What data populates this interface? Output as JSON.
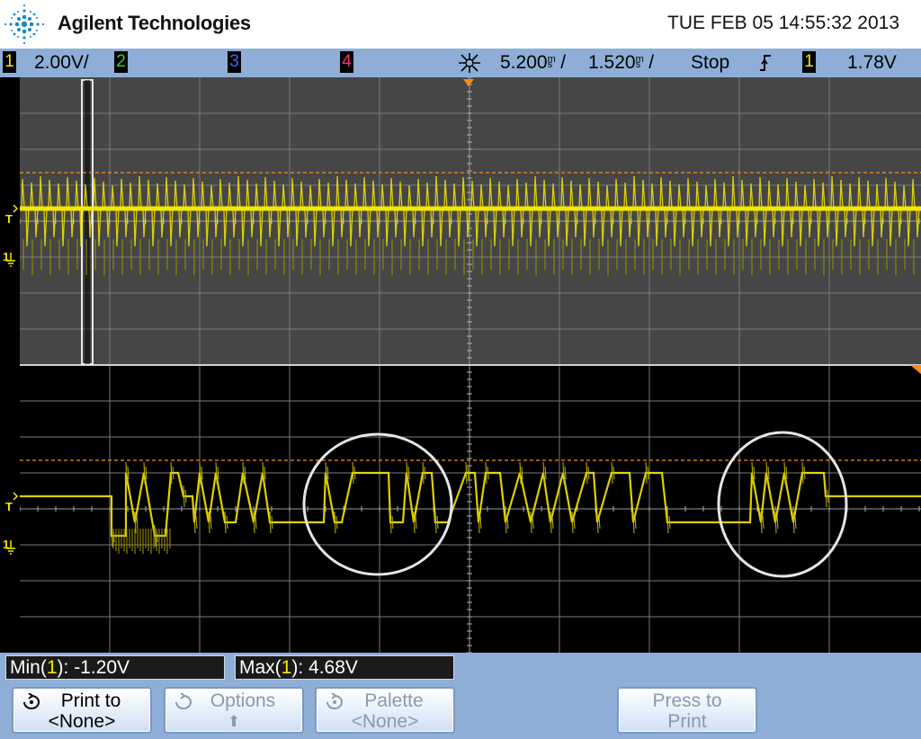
{
  "header": {
    "brand": "Agilent Technologies",
    "datetime": "TUE FEB 05 14:55:32 2013",
    "logo_icon": "agilent-spark-logo-icon"
  },
  "statusbar": {
    "ch1_label": "1",
    "ch1_scale": "2.00V/",
    "ch2_label": "2",
    "ch3_label": "3",
    "ch4_label": "4",
    "timebase_icon": "acquisition-zoom-icon",
    "delay": "5.200s/",
    "timescale": "1.520ms/",
    "run_state": "Stop",
    "trigger_slope_icon": "rising-edge-icon",
    "trigger_source": "1",
    "trigger_level": "1.78V",
    "colors": {
      "ch1": "#f5e800",
      "ch2": "#39d13a",
      "ch3": "#3f63ff",
      "ch4": "#ff2e7e"
    }
  },
  "screen": {
    "trigger_marker": "T",
    "ground_marker": "1",
    "trace_color": "#f5e800",
    "grid_color": "#7a7a7a",
    "cursor_color": "#ff8c1a"
  },
  "measurements": {
    "min_prefix": "Min(",
    "min_ch": "1",
    "min_suffix": "): -1.20V",
    "max_prefix": "Max(",
    "max_ch": "1",
    "max_suffix": "): 4.68V"
  },
  "softkeys": {
    "print_to": {
      "line1": "Print to",
      "line2": "<None>",
      "icon": "print-to-icon"
    },
    "options": {
      "line1": "Options",
      "line2": "⬆",
      "icon": "options-icon"
    },
    "palette": {
      "line1": "Palette",
      "line2": "<None>",
      "icon": "palette-icon"
    },
    "press_to_print": {
      "line1": "Press to",
      "line2": "Print"
    }
  }
}
